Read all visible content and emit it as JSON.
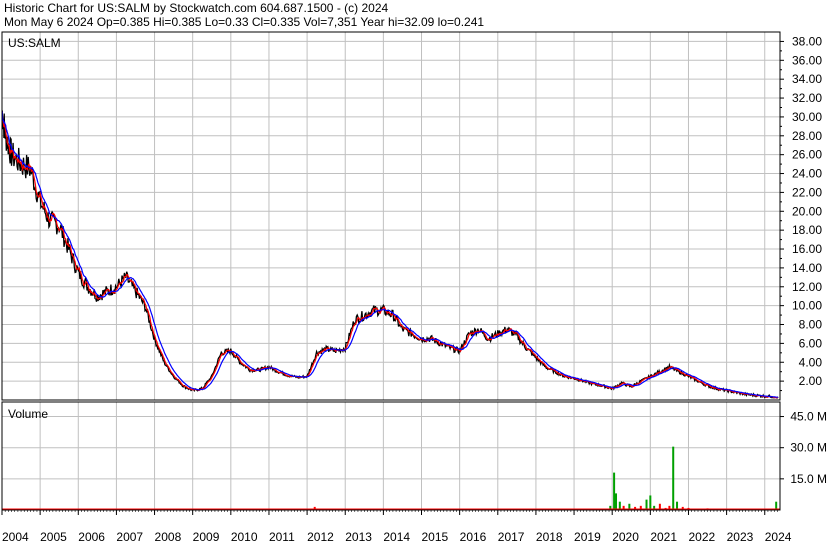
{
  "header": {
    "line1": "Historic Chart for US:SALM by Stockwatch.com 604.687.1500 - (c) 2024",
    "line2": "Mon May  6 2024   Op=0.385   Hi=0.385   Lo=0.33   Cl=0.335   Vol=7,351   Year hi=32.09   lo=0.241"
  },
  "colors": {
    "price": "#000000",
    "ma_short": "#ff0000",
    "ma_long": "#0000ff",
    "grid": "#c0c0c0",
    "volume_down": "#ff0000",
    "volume_up": "#00a000"
  },
  "chart_data": [
    {
      "type": "line",
      "label": "US:SALM",
      "y_ticks": [
        "38.00",
        "36.00",
        "34.00",
        "32.00",
        "30.00",
        "28.00",
        "26.00",
        "24.00",
        "22.00",
        "20.00",
        "18.00",
        "16.00",
        "14.00",
        "12.00",
        "10.00",
        "8.00",
        "6.00",
        "4.00",
        "2.00"
      ],
      "ylim": [
        0,
        39
      ],
      "x_ticks": [
        "2004",
        "2005",
        "2006",
        "2007",
        "2008",
        "2009",
        "2010",
        "2011",
        "2012",
        "2013",
        "2014",
        "2015",
        "2016",
        "2017",
        "2018",
        "2019",
        "2020",
        "2021",
        "2022",
        "2023",
        "2024"
      ],
      "grid": true,
      "series": [
        {
          "x": [
            2004.0,
            2004.1,
            2004.25,
            2004.5,
            2004.75,
            2005.0,
            2005.25,
            2005.5,
            2005.75,
            2006.0,
            2006.25,
            2006.5,
            2006.75,
            2007.0,
            2007.25,
            2007.5,
            2007.75,
            2008.0,
            2008.25,
            2008.5,
            2008.75,
            2009.0,
            2009.25,
            2009.5,
            2009.75,
            2010.0,
            2010.25,
            2010.5,
            2010.75,
            2011.0,
            2011.25,
            2011.5,
            2011.75,
            2012.0,
            2012.25,
            2012.5,
            2012.75,
            2013.0,
            2013.25,
            2013.5,
            2013.75,
            2014.0,
            2014.25,
            2014.5,
            2014.75,
            2015.0,
            2015.25,
            2015.5,
            2015.75,
            2016.0,
            2016.25,
            2016.5,
            2016.75,
            2017.0,
            2017.25,
            2017.5,
            2017.75,
            2018.0,
            2018.25,
            2018.5,
            2018.75,
            2019.0,
            2019.25,
            2019.5,
            2019.75,
            2020.0,
            2020.25,
            2020.5,
            2020.75,
            2021.0,
            2021.25,
            2021.5,
            2021.75,
            2022.0,
            2022.25,
            2022.5,
            2022.75,
            2023.0,
            2023.25,
            2023.5,
            2023.75,
            2024.0,
            2024.35
          ],
          "values": [
            30.5,
            28.0,
            26.0,
            25.0,
            24.5,
            21.0,
            19.0,
            18.5,
            16.0,
            13.5,
            12.0,
            11.0,
            11.5,
            12.0,
            13.0,
            11.5,
            10.0,
            6.5,
            4.0,
            2.5,
            1.5,
            1.0,
            1.2,
            2.5,
            5.0,
            5.2,
            4.0,
            3.2,
            3.2,
            3.5,
            3.0,
            2.6,
            2.4,
            2.5,
            5.0,
            5.4,
            5.2,
            5.5,
            8.5,
            9.0,
            9.5,
            9.5,
            9.0,
            7.5,
            7.0,
            6.5,
            6.5,
            6.0,
            5.5,
            5.2,
            7.0,
            7.5,
            6.5,
            7.0,
            7.5,
            6.8,
            5.5,
            4.5,
            3.5,
            3.0,
            2.5,
            2.3,
            2.0,
            1.7,
            1.5,
            1.2,
            1.8,
            1.4,
            2.0,
            2.5,
            3.0,
            3.5,
            3.0,
            2.5,
            2.0,
            1.5,
            1.2,
            1.0,
            0.8,
            0.6,
            0.5,
            0.4,
            0.335
          ]
        }
      ]
    },
    {
      "type": "bar",
      "label": "Volume",
      "y_ticks": [
        "45.0 M",
        "30.0 M",
        "15.0 M"
      ],
      "ylim": [
        0,
        52
      ],
      "x": [
        2004.5,
        2005.5,
        2006.5,
        2007.5,
        2008.5,
        2009.5,
        2010.5,
        2011.5,
        2012.2,
        2012.5,
        2013.5,
        2014.5,
        2015.5,
        2016.5,
        2017.5,
        2018.5,
        2019.5,
        2019.95,
        2020.05,
        2020.1,
        2020.2,
        2020.3,
        2020.45,
        2020.6,
        2020.75,
        2020.9,
        2021.0,
        2021.1,
        2021.25,
        2021.4,
        2021.5,
        2021.6,
        2021.7,
        2021.85,
        2022.0,
        2022.5,
        2023.0,
        2023.5,
        2024.0,
        2024.3
      ],
      "values": [
        0.5,
        0.5,
        0.4,
        0.4,
        0.3,
        0.3,
        0.3,
        0.3,
        1.5,
        0.3,
        0.3,
        0.3,
        0.3,
        0.3,
        0.3,
        0.3,
        0.5,
        2.0,
        18.0,
        8.0,
        4.0,
        2.0,
        3.0,
        1.5,
        2.0,
        5.0,
        7.0,
        2.0,
        3.0,
        1.0,
        2.0,
        30.5,
        4.0,
        1.5,
        1.0,
        0.8,
        0.6,
        0.5,
        0.7,
        4.0
      ]
    }
  ]
}
